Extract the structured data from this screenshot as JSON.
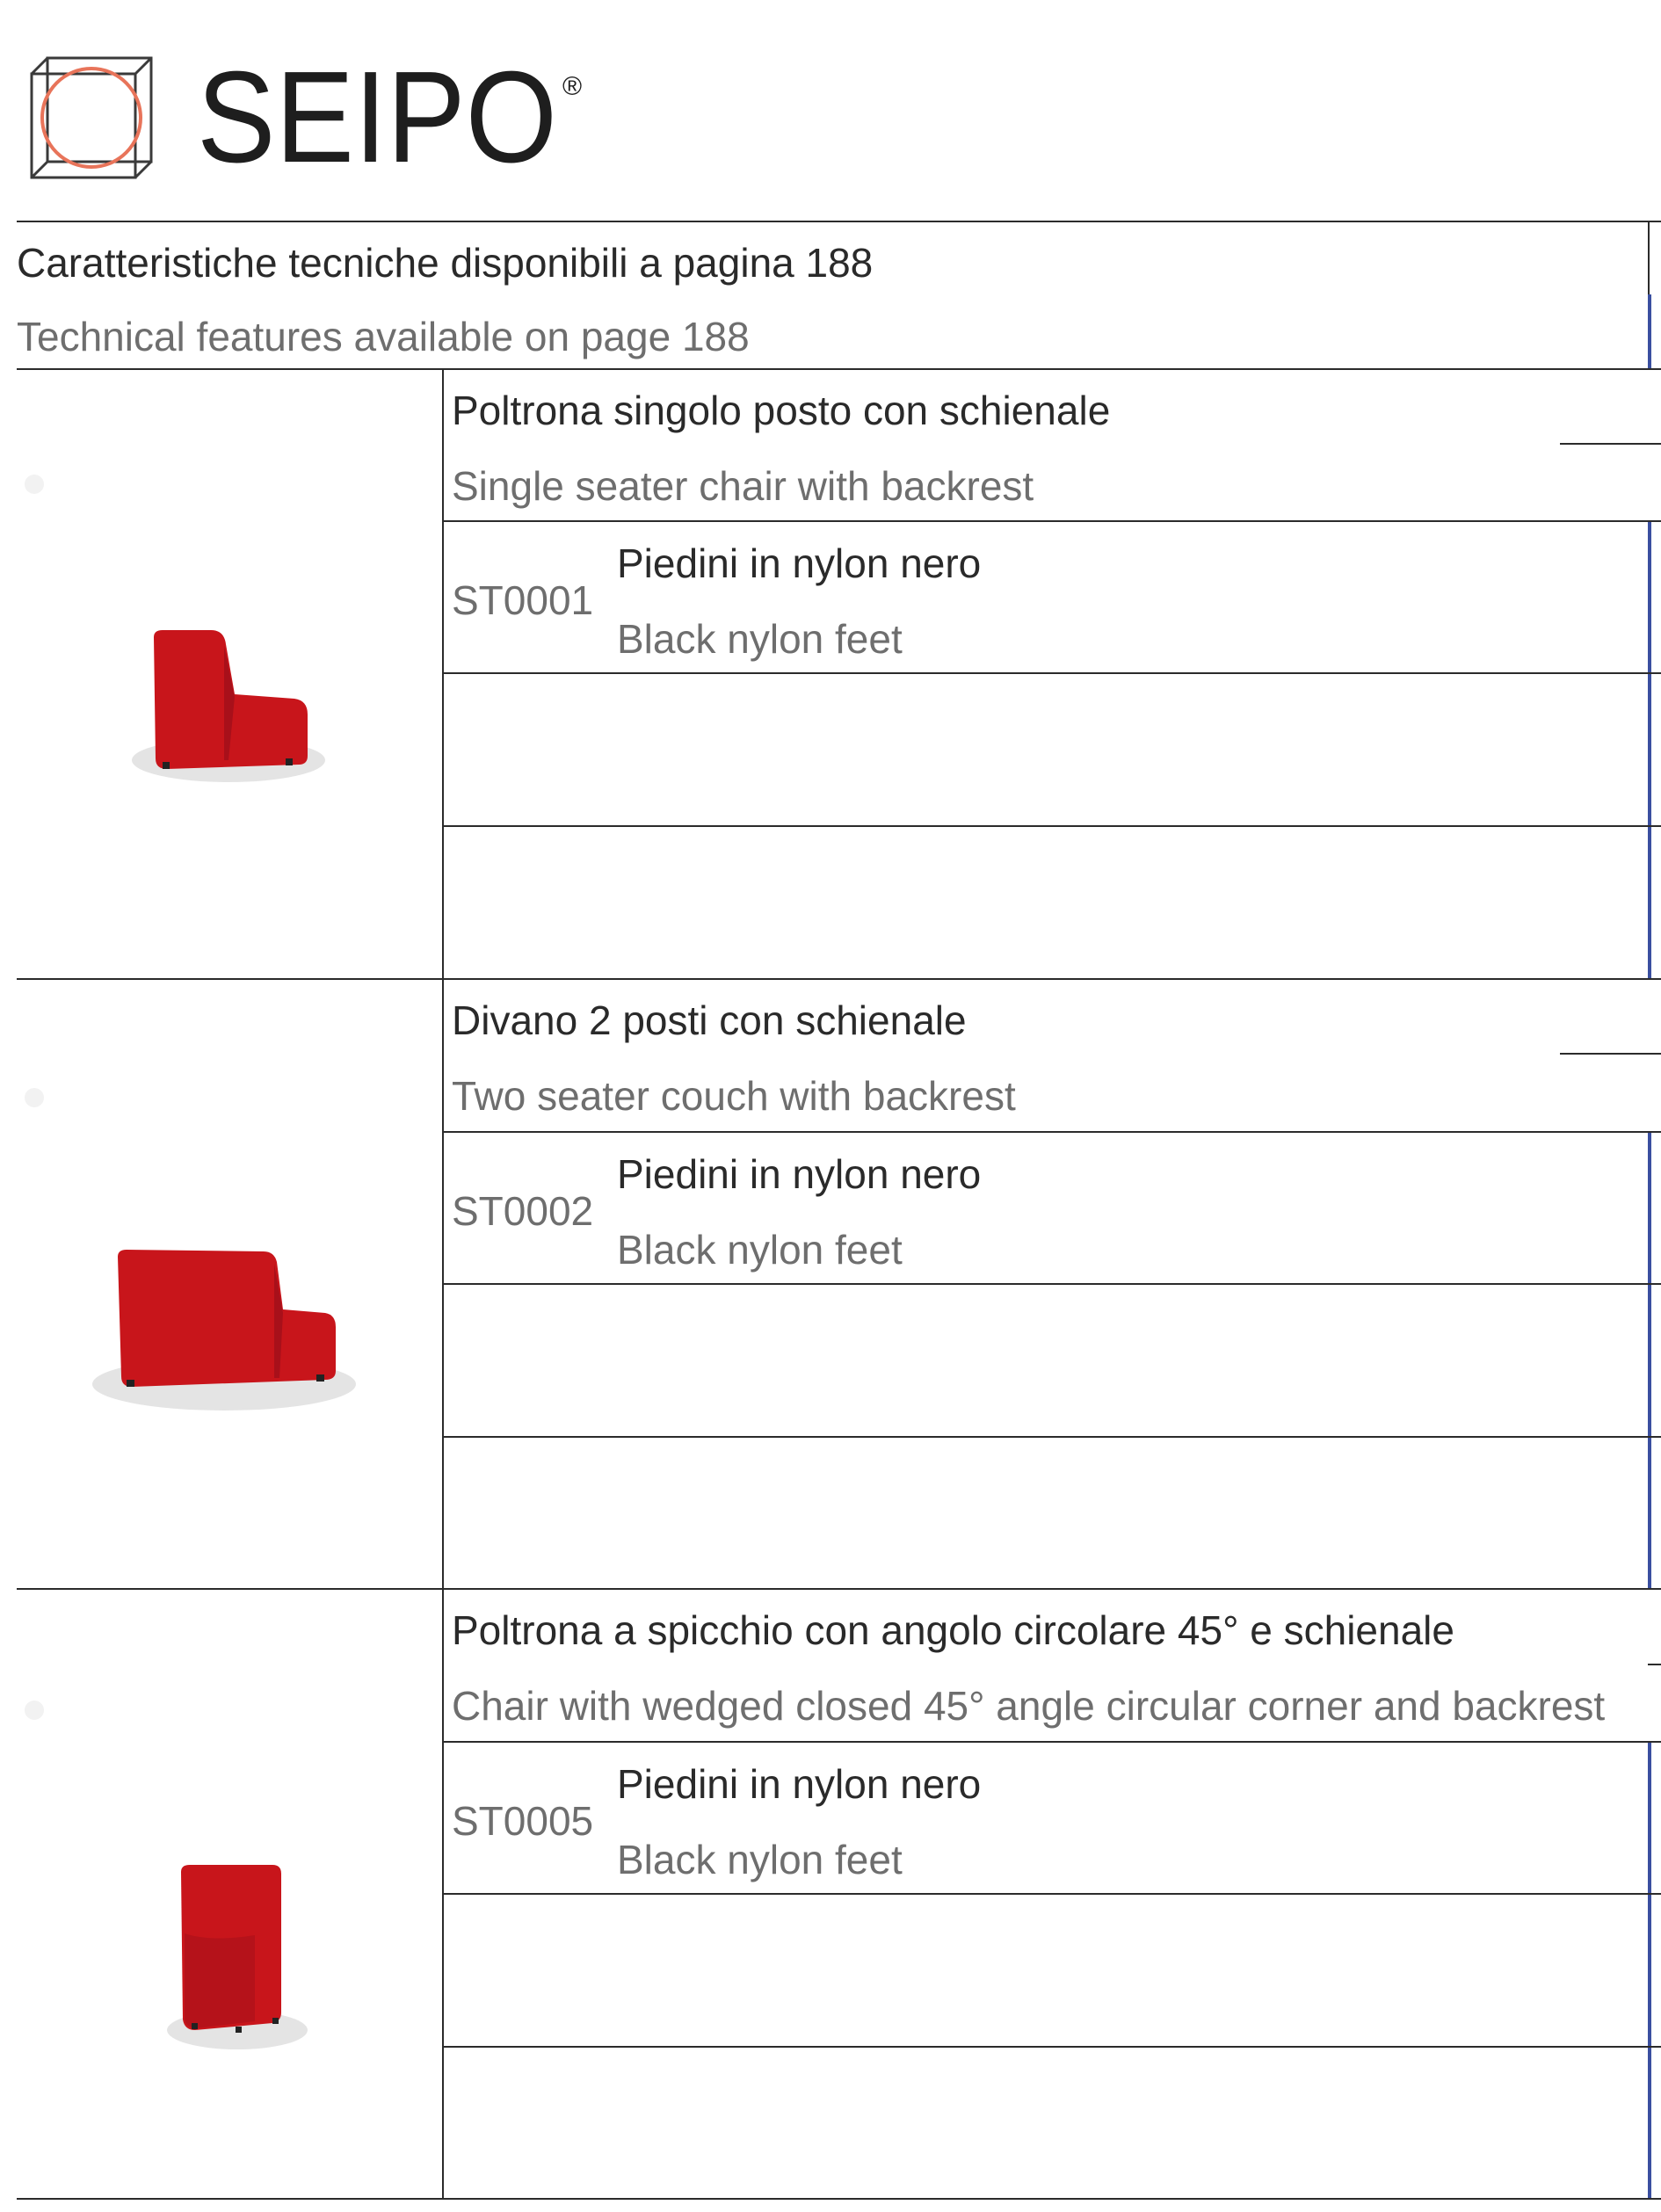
{
  "brand": {
    "name": "SEIPO",
    "registered_mark": "®"
  },
  "header": {
    "title_it": "Caratteristiche tecniche disponibili a pagina 188",
    "title_en": "Technical features available on page 188"
  },
  "products": [
    {
      "name_it": "Poltrona singolo posto con schienale",
      "name_en": "Single seater chair with backrest",
      "code": "ST0001",
      "option_it": "Piedini in nylon nero",
      "option_en": "Black nylon feet",
      "image": "red-single-chair"
    },
    {
      "name_it": "Divano 2 posti con schienale",
      "name_en": "Two seater couch with backrest",
      "code": "ST0002",
      "option_it": "Piedini in nylon nero",
      "option_en": "Black nylon feet",
      "image": "red-two-seater-couch"
    },
    {
      "name_it": "Poltrona a spicchio con angolo circolare 45° e schienale",
      "name_en": "Chair with wedged closed 45° angle circular corner and backrest",
      "code": "ST0005",
      "option_it": "Piedini in nylon nero",
      "option_en": "Black nylon feet",
      "image": "red-wedge-chair"
    }
  ],
  "colors": {
    "upholstery": "#c8151b",
    "logo_circle": "#e8745a",
    "logo_lines": "#3a3a3a",
    "accent_border": "#3a4fa0"
  }
}
